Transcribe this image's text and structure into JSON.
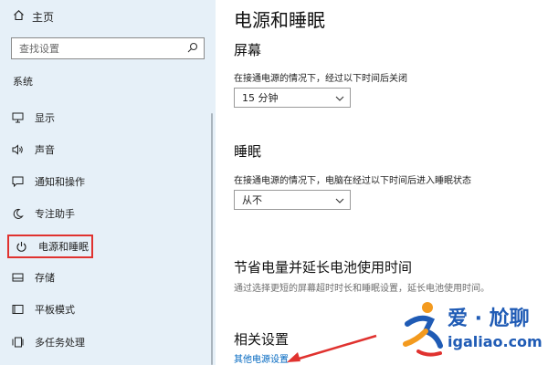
{
  "sidebar": {
    "home_label": "主页",
    "search_placeholder": "查找设置",
    "section_label": "系统",
    "items": [
      {
        "label": "显示",
        "icon": "monitor-icon"
      },
      {
        "label": "声音",
        "icon": "speaker-icon"
      },
      {
        "label": "通知和操作",
        "icon": "notification-icon"
      },
      {
        "label": "专注助手",
        "icon": "moon-icon"
      },
      {
        "label": "电源和睡眠",
        "icon": "power-icon",
        "selected": true
      },
      {
        "label": "存储",
        "icon": "storage-icon"
      },
      {
        "label": "平板模式",
        "icon": "tablet-icon"
      },
      {
        "label": "多任务处理",
        "icon": "multitask-icon"
      }
    ]
  },
  "main": {
    "title": "电源和睡眠",
    "screen": {
      "heading": "屏幕",
      "desc": "在接通电源的情况下，经过以下时间后关闭",
      "value": "15 分钟"
    },
    "sleep": {
      "heading": "睡眠",
      "desc": "在接通电源的情况下，电脑在经过以下时间后进入睡眠状态",
      "value": "从不"
    },
    "battery": {
      "heading": "节省电量并延长电池使用时间",
      "desc": "通过选择更短的屏幕超时时长和睡眠设置，延长电池使用时间。"
    },
    "related": {
      "heading": "相关设置",
      "link": "其他电源设置"
    }
  },
  "watermark": {
    "line1": "爱 · 尬聊",
    "line2": "igaliao.com"
  },
  "colors": {
    "sidebar_bg": "#e6f0f8",
    "accent_link": "#0067c0",
    "highlight_box": "#e0322f",
    "arrow": "#e0322f",
    "watermark_blue": "#1f5bb5",
    "watermark_orange": "#f39a1e"
  }
}
